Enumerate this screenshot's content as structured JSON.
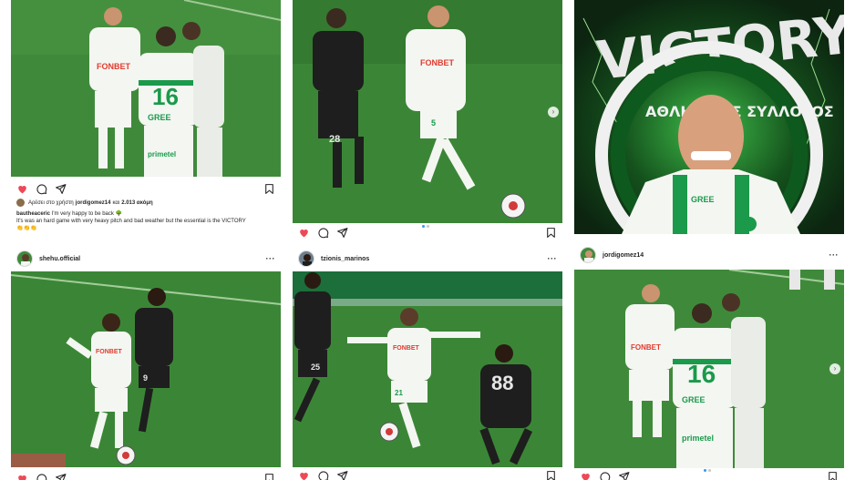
{
  "posts": [
    {
      "username": "",
      "liked": true,
      "liked_by_prefix": "Αρέσει στο χρήστη",
      "liked_by_user": "jordigomez14",
      "liked_by_and": "και",
      "liked_by_others": "2.013 ακόμη",
      "caption_user": "bautheaceric",
      "caption_line1": "I'm very happy to be back 🌳",
      "caption_line2": "It's was an hard game with very heavy pitch and bad weather but the essential is the VICTORY",
      "caption_emojis": "👏👏👏",
      "photo": {
        "sponsor": "FONBET",
        "number": "16",
        "brand": "GREE",
        "sponsor2": "primetel"
      }
    },
    {
      "username": "",
      "liked": true,
      "photo": {
        "sponsor": "FONBET",
        "number_home": "5",
        "number_away": "28"
      }
    },
    {
      "username": "",
      "photo": {
        "headline": "VICTORY!",
        "crest_text": "ΑΘΛΗΤΙΚΟΣ ΣΥΛΛΟΓΟΣ",
        "shirt_brand": "GREE"
      }
    },
    {
      "username": "shehu.official",
      "more": "···",
      "liked": true,
      "photo": {
        "sponsor": "FONBET",
        "number_away": "9"
      }
    },
    {
      "username": "tzionis_marinos",
      "more": "···",
      "liked": true,
      "photo": {
        "sponsor": "FONBET",
        "number_home": "21",
        "number_away": "88",
        "number_away2": "25"
      }
    },
    {
      "username": "jordigomez14",
      "more": "···",
      "liked": true,
      "photo": {
        "sponsor": "FONBET",
        "number": "16",
        "brand": "GREE",
        "sponsor2": "primetel"
      }
    }
  ],
  "colors": {
    "pitch": "#3f8a3a",
    "pitch_dark": "#2f6f2c",
    "home_kit": "#f4f6f2",
    "home_accent": "#1a9a4a",
    "away_kit": "#1e1e1e",
    "like_red": "#ed4956",
    "victory_bg": "#0c2410",
    "victory_glow": "#3fbf4a"
  },
  "icons": [
    "heart-icon",
    "comment-icon",
    "share-icon",
    "bookmark-icon",
    "more-icon",
    "next-arrow-icon"
  ]
}
